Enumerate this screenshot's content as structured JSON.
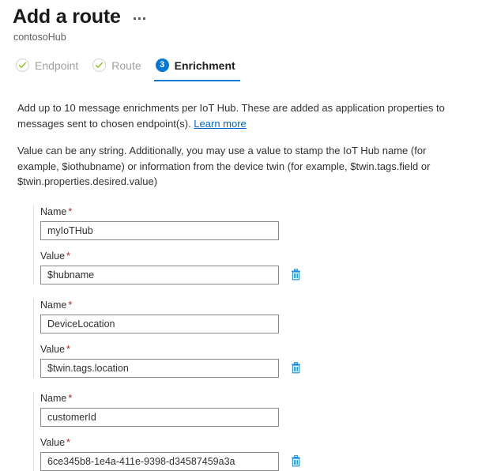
{
  "header": {
    "title": "Add a route",
    "subtitle": "contosoHub",
    "more_menu": "…"
  },
  "wizard": {
    "tabs": [
      {
        "label": "Endpoint",
        "state": "done",
        "icon": "check-circle-icon"
      },
      {
        "label": "Route",
        "state": "done",
        "icon": "check-circle-icon"
      },
      {
        "label": "Enrichment",
        "state": "active",
        "badge": "3"
      }
    ]
  },
  "description": {
    "paragraph1_part1": "Add up to 10 message enrichments per IoT Hub. These are added as application properties to messages sent to chosen endpoint(s). ",
    "learn_more": "Learn more",
    "paragraph2": "Value can be any string. Additionally, you may use a value to stamp the IoT Hub name (for example, $iothubname) or information from the device twin (for example, $twin.tags.field or $twin.properties.desired.value)"
  },
  "labels": {
    "name": "Name",
    "value": "Value",
    "required_marker": "*"
  },
  "enrichments": [
    {
      "name_value": "myIoTHub",
      "value_value": "$hubname",
      "delete_icon": "trash-icon"
    },
    {
      "name_value": "DeviceLocation",
      "value_value": "$twin.tags.location",
      "delete_icon": "trash-icon"
    },
    {
      "name_value": "customerId",
      "value_value": "6ce345b8-1e4a-411e-9398-d34587459a3a",
      "delete_icon": "trash-icon"
    }
  ],
  "colors": {
    "accent": "#0078d4",
    "link": "#0066cc",
    "required": "#a4262c",
    "check_green": "#7fba00",
    "divider": "#e1dfdd",
    "input_border": "#8a8886"
  }
}
